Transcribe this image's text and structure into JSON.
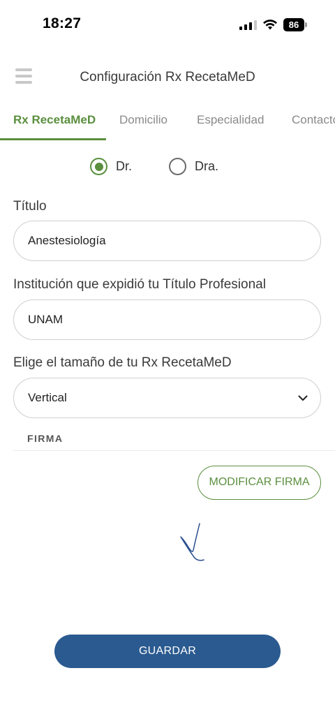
{
  "status_bar": {
    "time": "18:27",
    "battery": "86"
  },
  "header": {
    "title": "Configuración Rx RecetaMeD"
  },
  "tabs": [
    {
      "label": "Rx RecetaMeD"
    },
    {
      "label": "Domicilio"
    },
    {
      "label": "Especialidad"
    },
    {
      "label": "Contacto"
    }
  ],
  "gender": {
    "options": [
      "Dr.",
      "Dra."
    ],
    "selected": "Dr."
  },
  "form": {
    "titulo_label": "Título",
    "titulo_value": "Anestesiología",
    "institucion_label": "Institución que expidió tu Título Profesional",
    "institucion_value": "UNAM",
    "tamano_label": "Elige el tamaño de tu Rx RecetaMeD",
    "tamano_value": "Vertical"
  },
  "firma": {
    "section_title": "FIRMA",
    "modify_label": "MODIFICAR FIRMA"
  },
  "actions": {
    "save_label": "GUARDAR"
  },
  "colors": {
    "accent": "#5a8f3e",
    "primary": "#2a5a8f"
  },
  "icons": [
    "hamburger-icon",
    "signal-icon",
    "wifi-icon",
    "battery-icon",
    "chevron-down-icon"
  ]
}
